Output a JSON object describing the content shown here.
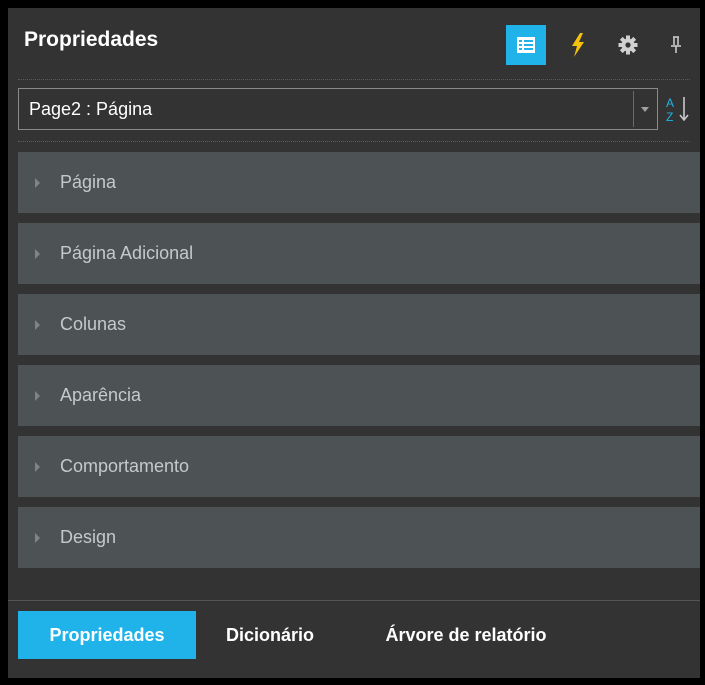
{
  "header": {
    "title": "Propriedades",
    "icons": [
      "list-icon",
      "lightning-icon",
      "gear-icon",
      "pin-icon"
    ]
  },
  "object_selector": {
    "value": "Page2 : Página",
    "sort_icon": "sort-alphabetical-icon"
  },
  "categories": [
    {
      "label": "Página"
    },
    {
      "label": "Página Adicional"
    },
    {
      "label": "Colunas"
    },
    {
      "label": "Aparência"
    },
    {
      "label": "Comportamento"
    },
    {
      "label": "Design"
    }
  ],
  "tabs": [
    {
      "label": "Propriedades",
      "active": true
    },
    {
      "label": "Dicionário",
      "active": false
    },
    {
      "label": "Árvore de relatório",
      "active": false
    }
  ],
  "colors": {
    "accent": "#1fb3ea",
    "panel_bg": "#333333",
    "category_bg": "#4d5354",
    "lightning": "#f4c20d"
  },
  "sort_labels": {
    "top": "A",
    "bottom": "Z"
  }
}
